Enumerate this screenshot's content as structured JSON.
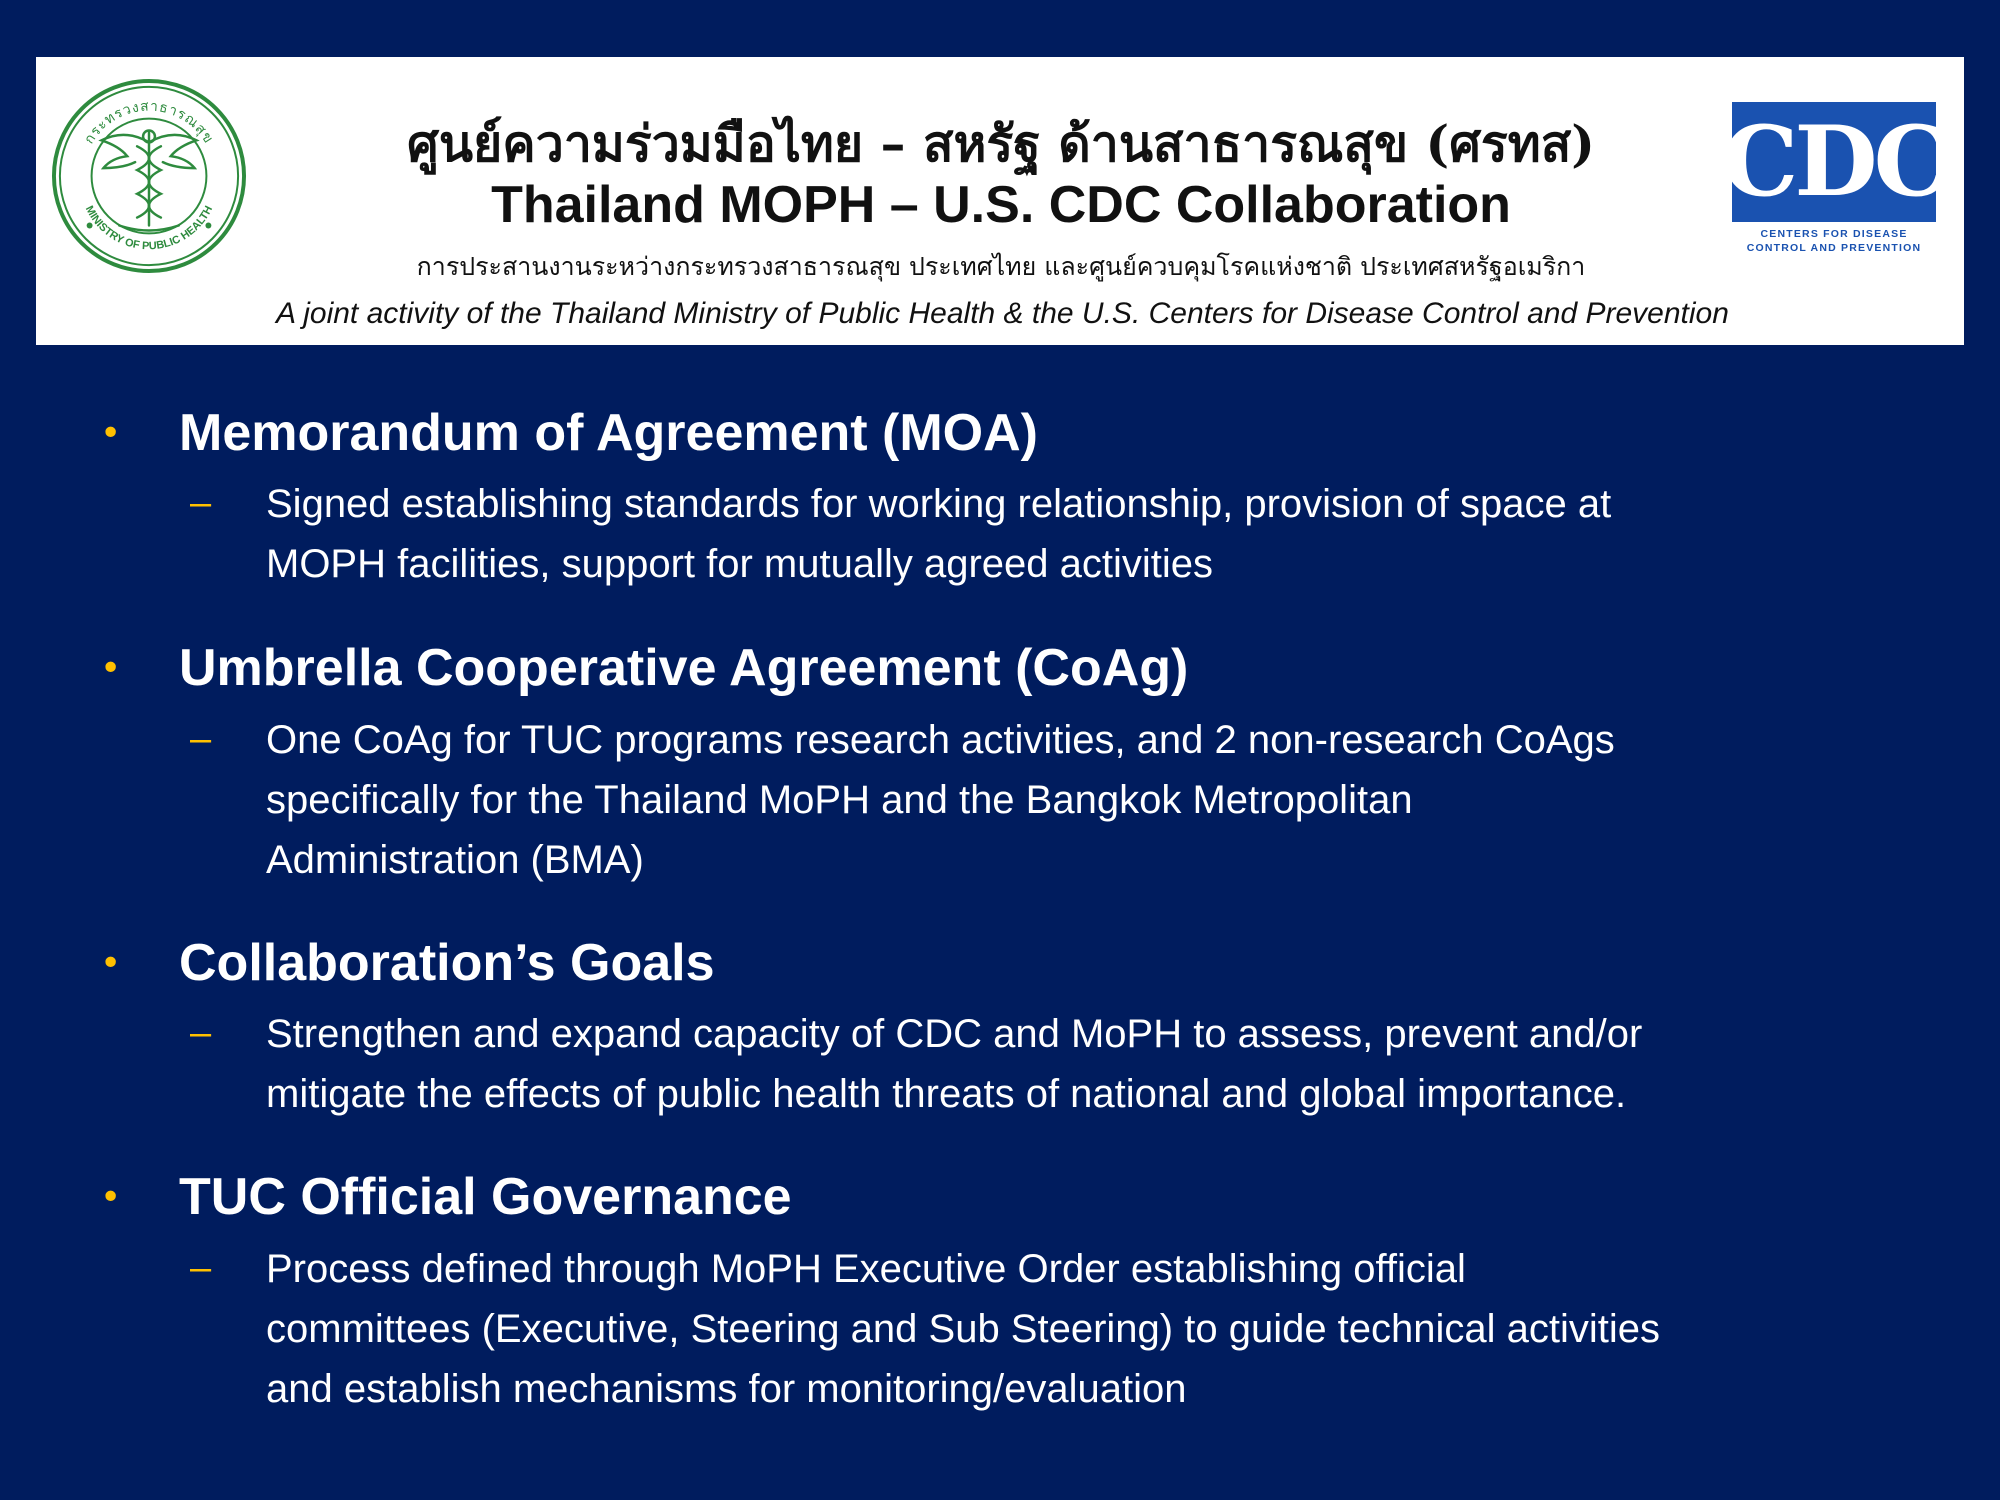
{
  "header": {
    "thai_title": "ศูนย์ความร่วมมือไทย – สหรัฐ ด้านสาธารณสุข (ศรทส)",
    "en_title": "Thailand MOPH – U.S. CDC Collaboration",
    "thai_subtitle": "การประสานงานระหว่างกระทรวงสาธารณสุข ประเทศไทย และศูนย์ควบคุมโรคแห่งชาติ ประเทศสหรัฐอเมริกา",
    "en_subtitle": "A joint activity of the Thailand Ministry of Public Health & the U.S. Centers for Disease Control and Prevention",
    "seal": {
      "top_text": "กระทรวงสาธารณสุข",
      "bottom_text": "MINISTRY OF PUBLIC HEALTH",
      "color": "#2e8b3e"
    },
    "cdc_logo": {
      "word": "CDC",
      "caption_line1": "CENTERS FOR DISEASE",
      "caption_line2": "CONTROL AND PREVENTION",
      "color": "#1a52b0"
    }
  },
  "colors": {
    "background": "#001c5e",
    "accent": "#ffc000",
    "text": "#ffffff"
  },
  "sections": [
    {
      "heading": "Memorandum of Agreement (MOA)",
      "text": "Signed establishing standards for working relationship, provision of space at\nMOPH facilities, support for mutually agreed activities"
    },
    {
      "heading": "Umbrella Cooperative Agreement (CoAg)",
      "text": "One CoAg for TUC programs research activities, and 2 non-research CoAgs\nspecifically for the Thailand MoPH and the Bangkok Metropolitan\nAdministration (BMA)"
    },
    {
      "heading": "Collaboration’s Goals",
      "text": "Strengthen and expand capacity of CDC and MoPH to assess, prevent and/or\nmitigate the effects of public health threats of national and global importance."
    },
    {
      "heading": "TUC Official Governance",
      "text": "Process defined through MoPH Executive Order establishing official\ncommittees (Executive, Steering and Sub Steering) to guide technical activities\nand establish mechanisms for monitoring/evaluation"
    }
  ]
}
